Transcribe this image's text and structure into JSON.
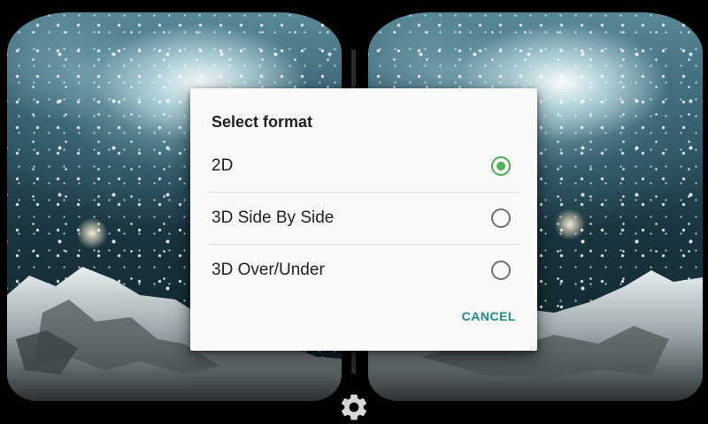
{
  "dialog": {
    "title": "Select format",
    "options": [
      {
        "label": "2D",
        "selected": true
      },
      {
        "label": "3D Side By Side",
        "selected": false
      },
      {
        "label": "3D Over/Under",
        "selected": false
      }
    ],
    "cancel_label": "CANCEL"
  },
  "icons": {
    "settings": "gear-icon",
    "radio_selected": "radio-checked-icon",
    "radio_unselected": "radio-unchecked-icon"
  },
  "colors": {
    "accent_green": "#4caf50",
    "button_teal": "#1e8c8c",
    "dialog_bg": "#fafafa",
    "background": "#000000"
  }
}
